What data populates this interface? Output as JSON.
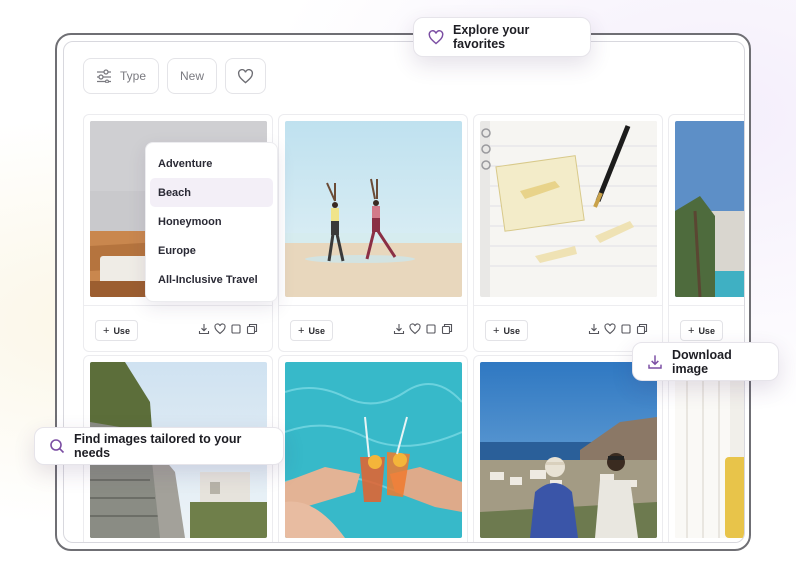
{
  "toolbar": {
    "type_label": "Type",
    "new_label": "New"
  },
  "type_dropdown": {
    "items": [
      "Adventure",
      "Beach",
      "Honeymoon",
      "Europe",
      "All-Inclusive Travel"
    ],
    "selected": "Beach"
  },
  "cards": [
    {
      "use_label": "Use"
    },
    {
      "use_label": "Use"
    },
    {
      "use_label": "Use"
    },
    {
      "use_label": "Use"
    }
  ],
  "callouts": {
    "favorites": "Explore your favorites",
    "download": "Download image",
    "find": "Find images tailored to your needs"
  },
  "colors": {
    "accent": "#7b4ea3",
    "text": "#1e1e24",
    "selected_bg": "#f3eff7"
  }
}
